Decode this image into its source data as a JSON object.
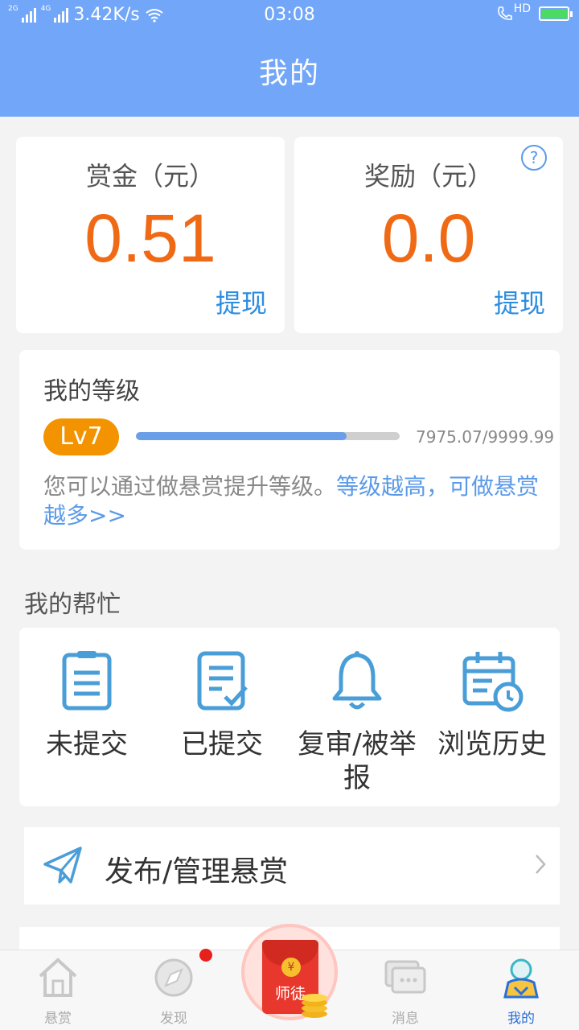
{
  "status_bar": {
    "net1": "2G",
    "net2": "4G",
    "speed": "3.42K/s",
    "time": "03:08",
    "call_tag": "HD"
  },
  "header": {
    "title": "我的"
  },
  "balance": {
    "bounty": {
      "title": "赏金（元）",
      "value": "0.51",
      "action": "提现"
    },
    "reward": {
      "title": "奖励（元）",
      "value": "0.0",
      "action": "提现",
      "help": "?"
    }
  },
  "level": {
    "title": "我的等级",
    "badge": "Lv7",
    "progress_text": "7975.07/9999.99",
    "progress_fraction": 0.7975,
    "desc": "您可以通过做悬赏提升等级。",
    "desc_link": "等级越高，可做悬赏越多>>"
  },
  "help_section": {
    "title": "我的帮忙",
    "items": [
      {
        "label": "未提交",
        "icon": "clipboard-icon"
      },
      {
        "label": "已提交",
        "icon": "submitted-doc-icon"
      },
      {
        "label": "复审/被举报",
        "icon": "bell-icon"
      },
      {
        "label": "浏览历史",
        "icon": "calendar-clock-icon"
      }
    ]
  },
  "publish": {
    "label": "发布/管理悬赏",
    "icon": "paper-plane-icon"
  },
  "bottom_nav": {
    "items": [
      {
        "label": "悬赏",
        "icon": "home-icon"
      },
      {
        "label": "发现",
        "icon": "discover-icon"
      },
      {
        "label": "消息",
        "icon": "message-icon"
      },
      {
        "label": "我的",
        "icon": "profile-icon"
      }
    ],
    "center": {
      "label": "师徒",
      "coin": "¥",
      "icon": "red-envelope-icon"
    }
  },
  "colors": {
    "header": "#72a6f8",
    "amount": "#f06a16",
    "link": "#2b8de0",
    "badge": "#f39300",
    "progress": "#6a9ee8",
    "icon": "#4a9ed8"
  }
}
